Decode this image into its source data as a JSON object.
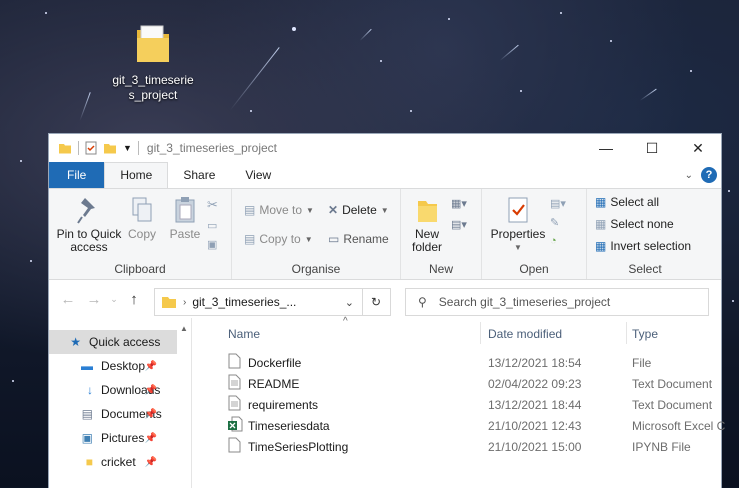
{
  "desktop": {
    "icon_label": "git_3_timeseries_project"
  },
  "window": {
    "title": "git_3_timeseries_project",
    "controls": {
      "minimize": "—",
      "maximize": "☐",
      "close": "✕"
    }
  },
  "tabs": [
    "File",
    "Home",
    "Share",
    "View"
  ],
  "ribbon": {
    "clipboard": {
      "label": "Clipboard",
      "pin": "Pin to Quick access",
      "copy": "Copy",
      "paste": "Paste"
    },
    "organise": {
      "label": "Organise",
      "move_to": "Move to",
      "copy_to": "Copy to",
      "delete": "Delete",
      "rename": "Rename"
    },
    "new": {
      "label": "New",
      "new_folder": "New folder"
    },
    "open": {
      "label": "Open",
      "properties": "Properties"
    },
    "select": {
      "label": "Select",
      "select_all": "Select all",
      "select_none": "Select none",
      "invert": "Invert selection"
    }
  },
  "address": {
    "path": "git_3_timeseries_...",
    "search_placeholder": "Search git_3_timeseries_project"
  },
  "nav": [
    {
      "label": "Quick access",
      "icon": "star-icon",
      "pinned": false,
      "selected": true
    },
    {
      "label": "Desktop",
      "icon": "desktop-icon",
      "pinned": true
    },
    {
      "label": "Downloads",
      "icon": "download-icon",
      "pinned": true
    },
    {
      "label": "Documents",
      "icon": "documents-icon",
      "pinned": true
    },
    {
      "label": "Pictures",
      "icon": "pictures-icon",
      "pinned": true
    },
    {
      "label": "cricket",
      "icon": "folder-icon",
      "pinned": true
    }
  ],
  "columns": {
    "name": "Name",
    "date": "Date modified",
    "type": "Type"
  },
  "files": [
    {
      "name": "Dockerfile",
      "date": "13/12/2021 18:54",
      "type": "File",
      "icon": "file-icon"
    },
    {
      "name": "README",
      "date": "02/04/2022 09:23",
      "type": "Text Document",
      "icon": "text-file-icon"
    },
    {
      "name": "requirements",
      "date": "13/12/2021 18:44",
      "type": "Text Document",
      "icon": "text-file-icon"
    },
    {
      "name": "Timeseriesdata",
      "date": "21/10/2021 12:43",
      "type": "Microsoft Excel C",
      "icon": "excel-icon"
    },
    {
      "name": "TimeSeriesPlotting",
      "date": "21/10/2021 15:00",
      "type": "IPYNB File",
      "icon": "file-icon"
    }
  ],
  "colors": {
    "file_tab": "#1f6bb5",
    "accent": "#1f6bb5",
    "folder": "#f5c94c"
  }
}
